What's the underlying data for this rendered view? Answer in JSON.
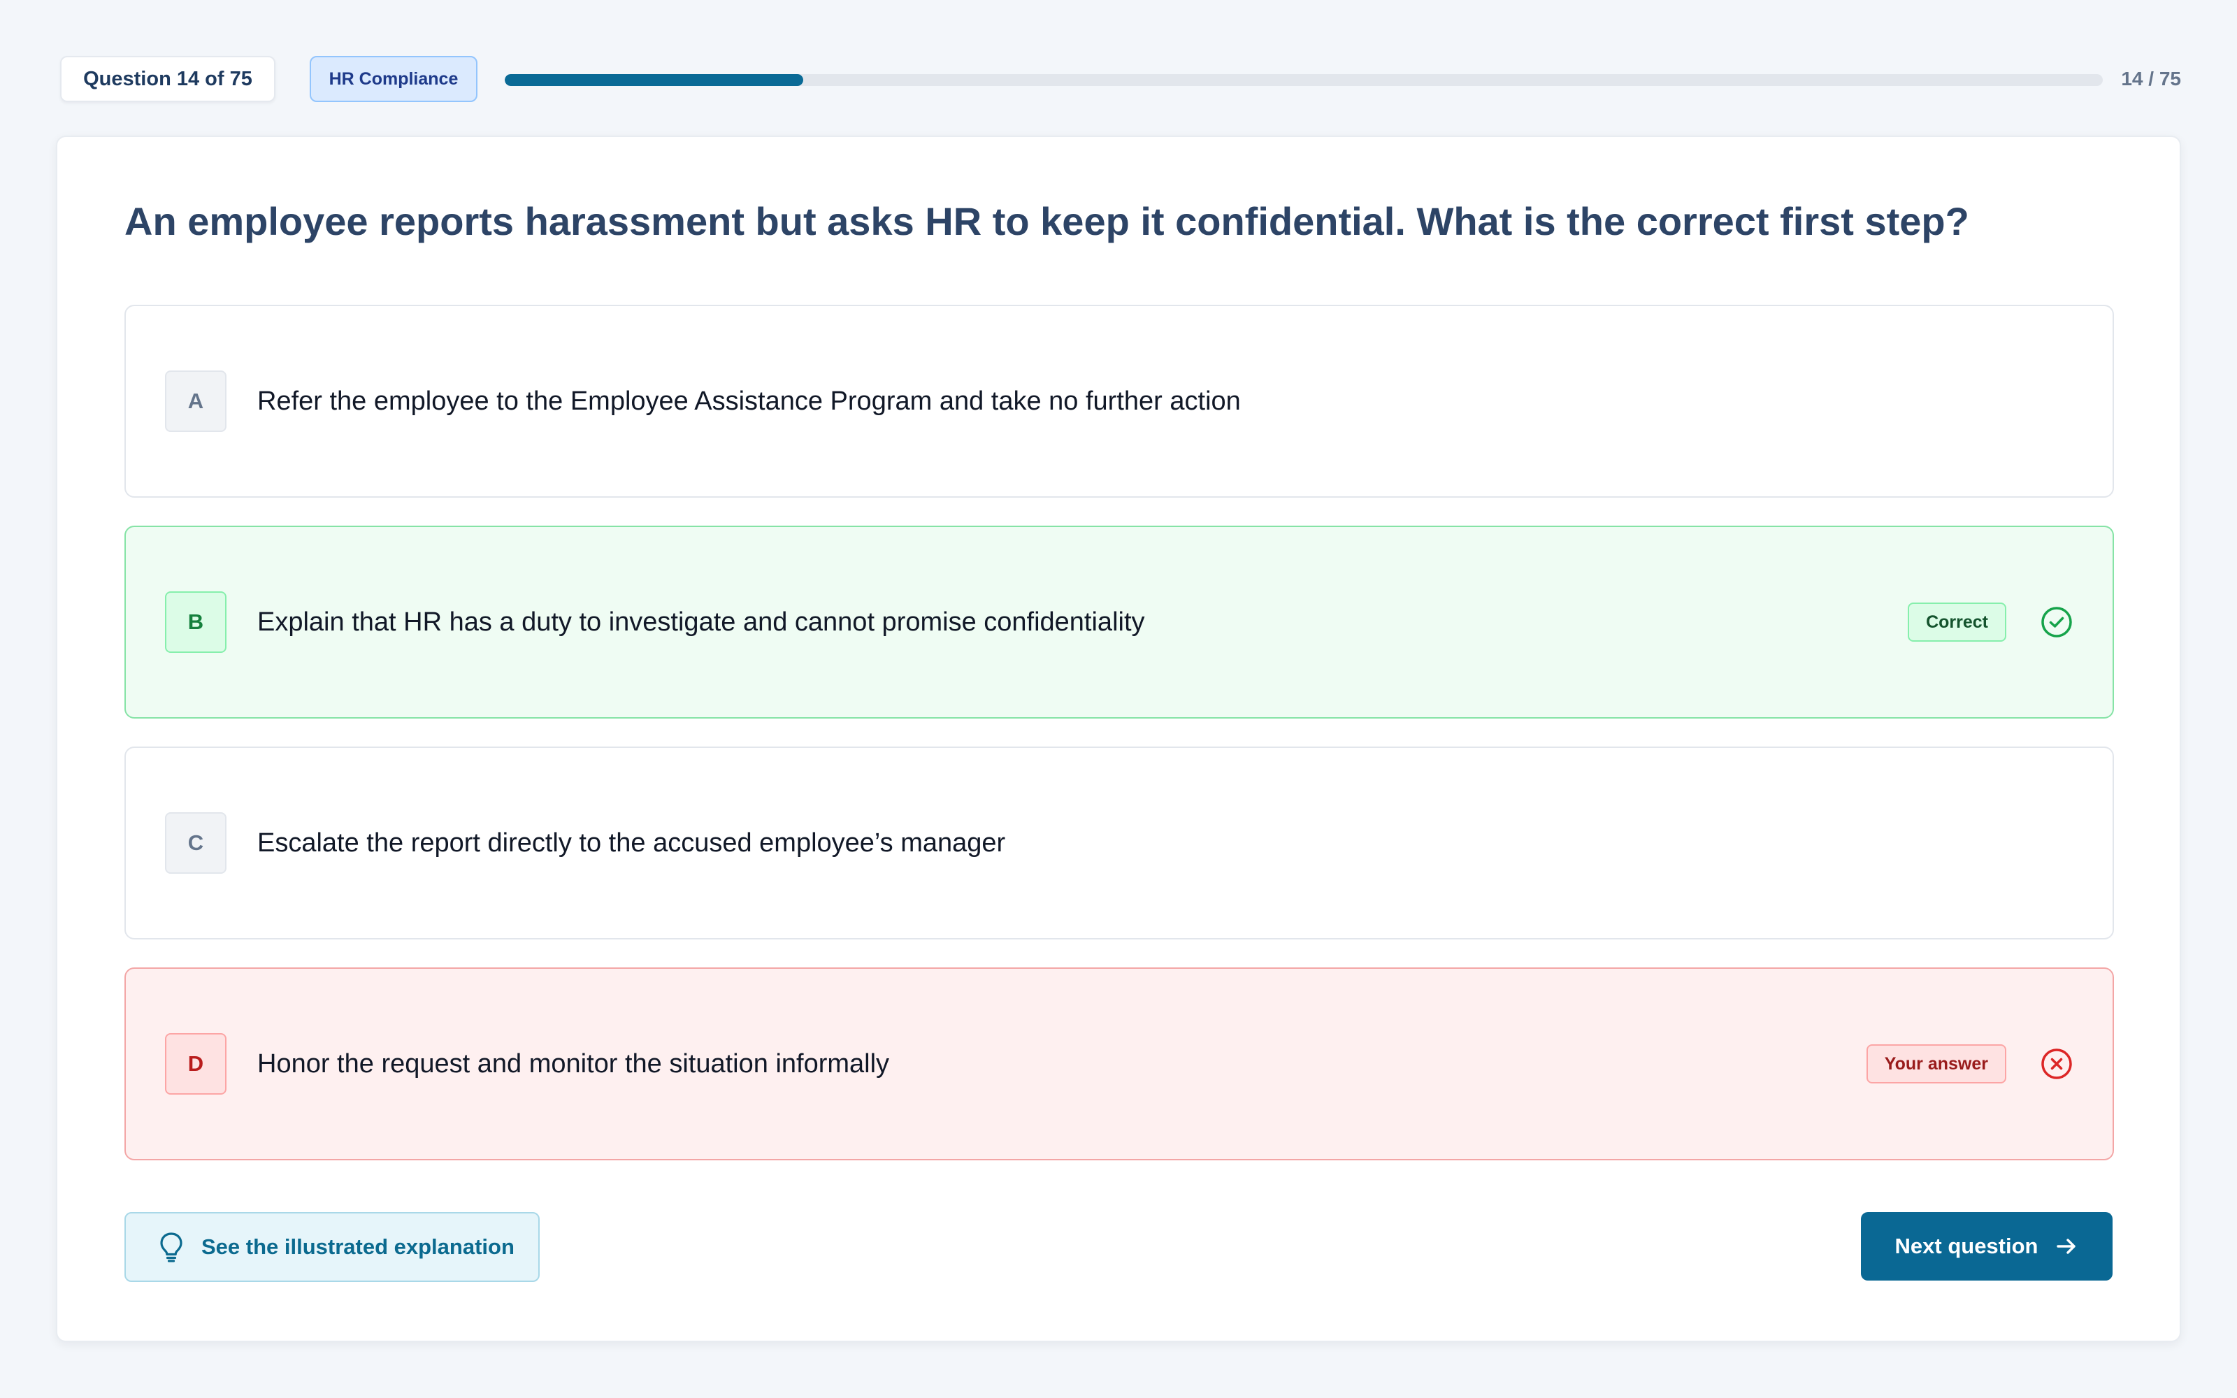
{
  "header": {
    "question_counter": "Question 14 of 75",
    "category": "HR Compliance",
    "progress_text": "14 / 75",
    "progress_current": 14,
    "progress_total": 75
  },
  "question": {
    "text": "An employee reports harassment but asks HR to keep it confidential. What is the correct first step?",
    "options": [
      {
        "letter": "A",
        "text": "Refer the employee to the Employee Assistance Program and take no further action",
        "state": "neutral"
      },
      {
        "letter": "B",
        "text": "Explain that HR has a duty to investigate and cannot promise confidentiality",
        "state": "correct",
        "tag": "Correct",
        "icon": "check-circle-icon"
      },
      {
        "letter": "C",
        "text": "Escalate the report directly to the accused employee’s manager",
        "state": "neutral"
      },
      {
        "letter": "D",
        "text": "Honor the request and monitor the situation informally",
        "state": "wrong",
        "tag": "Your answer",
        "icon": "x-circle-icon"
      }
    ]
  },
  "actions": {
    "explanation_label": "See the illustrated explanation",
    "explanation_icon": "lightbulb-icon",
    "next_label": "Next question",
    "next_icon": "arrow-right-icon"
  },
  "colors": {
    "accent": "#0a6894",
    "correct": "#16a34a",
    "wrong": "#dc2626",
    "background": "#f3f6fa"
  }
}
